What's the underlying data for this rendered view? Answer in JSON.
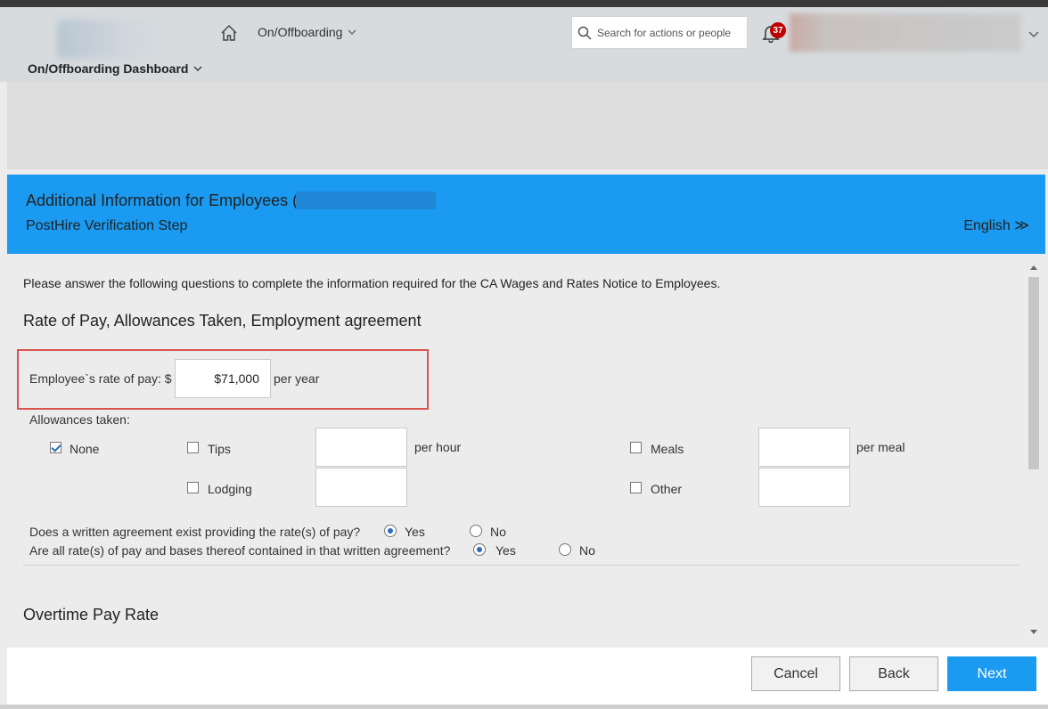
{
  "header": {
    "module_label": "On/Offboarding",
    "search_placeholder": "Search for actions or people",
    "notification_count": "37",
    "dashboard_label": "On/Offboarding Dashboard"
  },
  "form_header": {
    "title": "Additional Information for Employees (",
    "subtitle": "PostHire Verification Step",
    "language_link": "English ≫"
  },
  "content": {
    "intro": "Please answer the following questions to complete the information required for the CA Wages and Rates Notice to Employees.",
    "section1_title": "Rate of Pay, Allowances Taken, Employment agreement",
    "rate_label": "Employee`s rate of pay: $",
    "rate_value": "$71,000",
    "rate_unit": "per year",
    "allowances_label": "Allowances taken:",
    "allowances": {
      "none": {
        "label": "None",
        "checked": true
      },
      "tips": {
        "label": "Tips",
        "checked": false,
        "unit": "per hour"
      },
      "meals": {
        "label": "Meals",
        "checked": false,
        "unit": "per meal"
      },
      "lodging": {
        "label": "Lodging",
        "checked": false
      },
      "other": {
        "label": "Other",
        "checked": false
      }
    },
    "q1": {
      "text": "Does a written agreement exist providing the rate(s) of pay?",
      "yes": "Yes",
      "no": "No",
      "selected": "Yes"
    },
    "q2": {
      "text": "Are all rate(s) of pay and bases thereof contained in that written agreement?",
      "yes": "Yes",
      "no": "No",
      "selected": "Yes"
    },
    "section2_title": "Overtime Pay Rate"
  },
  "footer": {
    "cancel": "Cancel",
    "back": "Back",
    "next": "Next"
  },
  "colors": {
    "accent": "#1a9af0",
    "highlight_border": "#d9534f",
    "badge": "#c00000"
  }
}
